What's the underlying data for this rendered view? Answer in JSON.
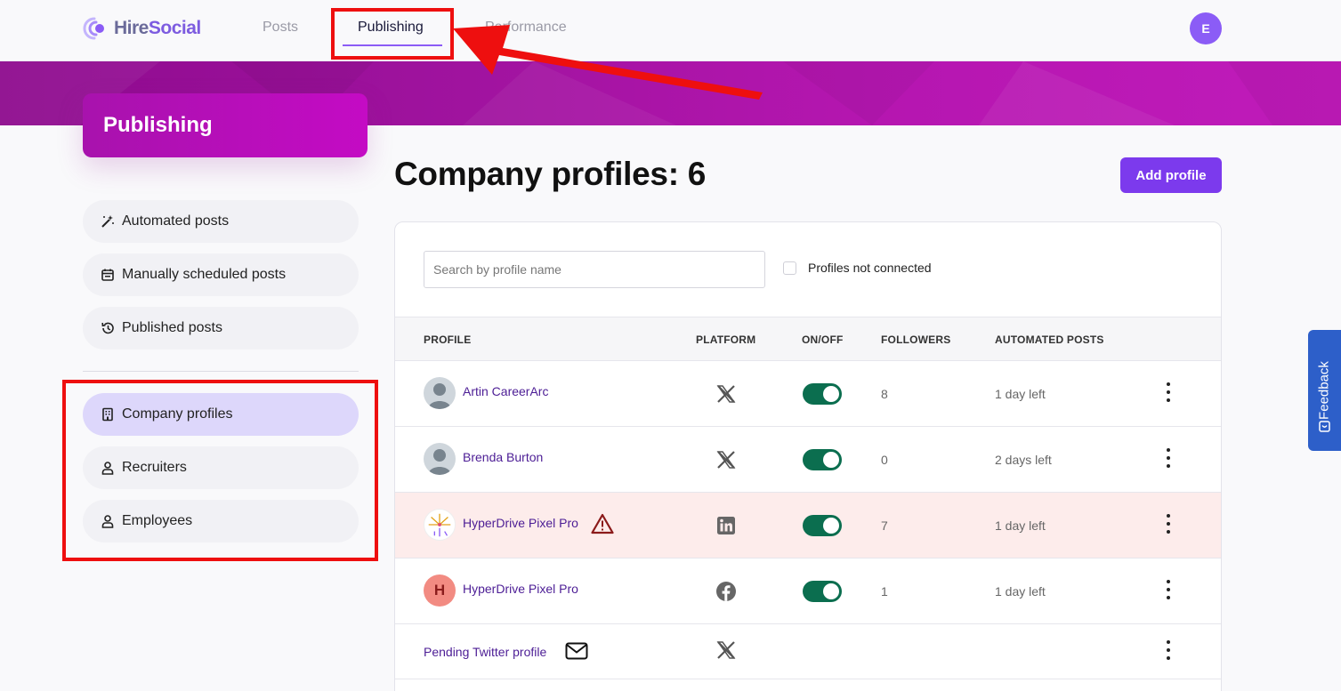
{
  "nav": {
    "logo_prefix": "Hire",
    "logo_suffix": "Social",
    "links": [
      "Posts",
      "Publishing",
      "Performance"
    ],
    "user_initial": "E"
  },
  "sidebar": {
    "title": "Publishing",
    "top_items": [
      {
        "label": "Automated posts",
        "icon": "magic-wand-icon"
      },
      {
        "label": "Manually scheduled posts",
        "icon": "calendar-icon"
      },
      {
        "label": "Published posts",
        "icon": "history-icon"
      }
    ],
    "bottom_items": [
      {
        "label": "Company profiles",
        "icon": "building-icon",
        "active": true
      },
      {
        "label": "Recruiters",
        "icon": "user-icon"
      },
      {
        "label": "Employees",
        "icon": "user-icon"
      }
    ]
  },
  "main": {
    "title": "Company profiles: 6",
    "add_button": "Add profile",
    "search_placeholder": "Search by profile name",
    "filter_label": "Profiles not connected",
    "columns": [
      "PROFILE",
      "PLATFORM",
      "ON/OFF",
      "FOLLOWERS",
      "AUTOMATED POSTS"
    ],
    "rows": [
      {
        "name": "Artin CareerArc",
        "avatar": "default-avatar",
        "platform": "x-icon",
        "enabled": true,
        "followers": "8",
        "automated": "1 day left",
        "warning": false
      },
      {
        "name": "Brenda Burton",
        "avatar": "default-avatar",
        "platform": "x-icon",
        "enabled": true,
        "followers": "0",
        "automated": "2 days left",
        "warning": false
      },
      {
        "name": "HyperDrive Pixel Pro",
        "avatar": "fireworks-avatar",
        "platform": "linkedin-icon",
        "enabled": true,
        "followers": "7",
        "automated": "1 day left",
        "warning": true
      },
      {
        "name": "HyperDrive Pixel Pro",
        "avatar": "letter-avatar",
        "avatar_letter": "H",
        "platform": "facebook-icon",
        "enabled": true,
        "followers": "1",
        "automated": "1 day left",
        "warning": false
      },
      {
        "name": "Pending Twitter profile",
        "avatar": "none",
        "platform": "x-icon",
        "enabled": null,
        "followers": "",
        "automated": "",
        "pending": true
      }
    ]
  },
  "feedback_label": "Feedback",
  "colors": {
    "accent": "#7c3aed",
    "banner": "#a812ad",
    "toggle_on": "#0b6e4f",
    "warning_row": "#fdeceb",
    "annotation": "#ee0f0f"
  }
}
